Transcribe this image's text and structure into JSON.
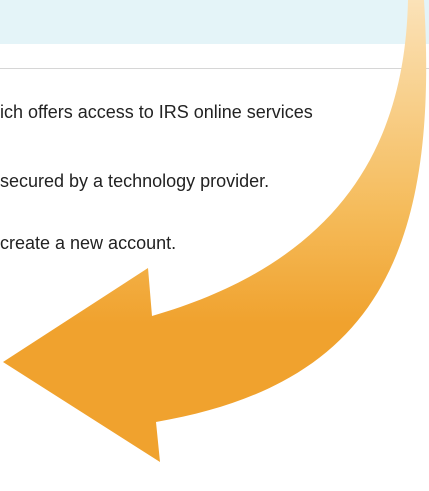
{
  "content": {
    "lines": [
      "ich offers access to IRS online services",
      "secured by a technology provider.",
      "create a new account."
    ]
  },
  "colors": {
    "banner": "#e4f4f8",
    "arrow": "#f0a22e",
    "arrow_tail": "#fbe2b8",
    "text": "#222222"
  },
  "icons": {
    "arrow": "curved-arrow-icon"
  }
}
